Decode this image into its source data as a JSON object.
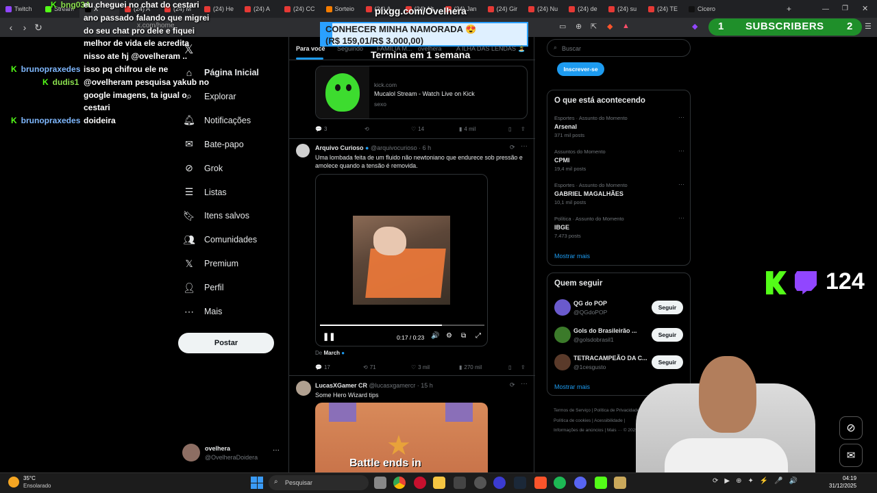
{
  "browser": {
    "tabs": [
      "Twitch",
      "Stream",
      "X",
      "(24) A",
      "(24) M",
      "(24) He",
      "(24) A",
      "(24) CC",
      "Sorteio",
      "(24) A",
      "(24) Alt",
      "(24) Jan",
      "(24) Gir",
      "(24) Nu",
      "(24) de",
      "(24) su",
      "(24) TE",
      "Cicero"
    ],
    "url": "x.com/home"
  },
  "stream_overlay": {
    "donation_url": "pixgg.com/Ovelhera",
    "goal_title": "CONHECER MINHA NAMORADA 😍",
    "goal_progress": "(R$ 159,01/R$ 3.000,00)",
    "goal_fraction": 0.053,
    "goal_deadline": "Termina em 1 semana",
    "subscribers_label": "SUBSCRIBERS",
    "subscribers_left": "1",
    "subscribers_right": "2",
    "viewer_count": "124"
  },
  "chat": [
    {
      "user": "bng034",
      "text": "eu cheguei no chat do cestari"
    },
    {
      "user": "",
      "text": "ano passado falando que migrei"
    },
    {
      "user": "",
      "text": "do seu chat pro dele e fiquei"
    },
    {
      "user": "",
      "text": "melhor de vida ele acredita"
    },
    {
      "user": "",
      "text": "nisso ate hj @ovelheram .."
    },
    {
      "user": "brunopraxedes",
      "text": "isso pq chifrou ele ne"
    },
    {
      "user": "dudis1",
      "text": "@ovelheram pesquisa yakub no"
    },
    {
      "user": "",
      "text": "google imagens, ta igual o"
    },
    {
      "user": "",
      "text": "cestari"
    },
    {
      "user": "brunopraxedes",
      "text": "doideira"
    }
  ],
  "sidebar": {
    "items": [
      {
        "label": "Página Inicial",
        "icon": "home-icon"
      },
      {
        "label": "Explorar",
        "icon": "search-icon"
      },
      {
        "label": "Notificações",
        "icon": "bell-icon"
      },
      {
        "label": "Bate-papo",
        "icon": "mail-icon"
      },
      {
        "label": "Grok",
        "icon": "grok-icon"
      },
      {
        "label": "Listas",
        "icon": "list-icon"
      },
      {
        "label": "Itens salvos",
        "icon": "bookmark-icon"
      },
      {
        "label": "Comunidades",
        "icon": "people-icon"
      },
      {
        "label": "Premium",
        "icon": "x-logo-icon"
      },
      {
        "label": "Perfil",
        "icon": "person-icon"
      },
      {
        "label": "Mais",
        "icon": "more-icon"
      }
    ],
    "post_label": "Postar",
    "account_name": "ovelhera",
    "account_handle": "@OvelheraDoidera"
  },
  "feed": {
    "tabs": [
      "Para você",
      "Seguindo",
      "FAMÍLIA M...",
      "ovelhera",
      "A ILHA DAS LENDAS 🏝️"
    ],
    "card": {
      "domain": "kick.com",
      "title": "Mucalol Stream - Watch Live on Kick",
      "desc": "sexo"
    },
    "card_actions": {
      "replies": "3",
      "likes": "14",
      "views": "4 mil"
    },
    "post": {
      "name": "Arquivo Curioso",
      "handle": "@arquivocurioso · 6 h",
      "text": "Uma lombada feita de um fluido não newtoniano que endurece sob pressão e amolece quando a tensão é removida.",
      "video_time": "0:17 / 0:23",
      "video_progress": 0.74,
      "from_label": "De",
      "from_name": "March",
      "replies": "17",
      "reposts": "71",
      "likes": "3 mil",
      "views": "270 mil"
    },
    "post2": {
      "name": "LucasXGamer CR",
      "handle": "@lucasxgamercr · 15 h",
      "text": "Some Hero Wizard tips",
      "image_caption": "Battle ends in"
    }
  },
  "right": {
    "search_placeholder": "Buscar",
    "subscribe_label": "Inscrever-se",
    "trending_title": "O que está acontecendo",
    "trends": [
      {
        "category": "Esportes · Assunto do Momento",
        "name": "Arsenal",
        "count": "371 mil posts"
      },
      {
        "category": "Assuntos do Momento",
        "name": "CPMI",
        "count": "19,4 mil posts"
      },
      {
        "category": "Esportes · Assunto do Momento",
        "name": "GABRIEL MAGALHÃES",
        "count": "10,1 mil posts"
      },
      {
        "category": "Política · Assunto do Momento",
        "name": "IBGE",
        "count": "7.473 posts"
      }
    ],
    "show_more": "Mostrar mais",
    "who_title": "Quem seguir",
    "who": [
      {
        "name": "QG do POP",
        "handle": "@QGdoPOP"
      },
      {
        "name": "Gols do Brasileirão ...",
        "handle": "@golsdobrasil1"
      },
      {
        "name": "TETRACAMPEÃO DA C...",
        "handle": "@1cesgusto"
      }
    ],
    "follow_label": "Seguir",
    "footer": [
      "Termos de Serviço",
      "Política de Privacidade",
      "Política de cookies",
      "Acessibilidade",
      "Informações de anúncios",
      "Mais ···",
      "© 2025 X Corp."
    ]
  },
  "taskbar": {
    "weather_temp": "35°C",
    "weather_desc": "Ensolarado",
    "search_placeholder": "Pesquisar",
    "time": "04:19",
    "date": "31/12/2025"
  },
  "colors": {
    "accent": "#1d9bf0",
    "kick_green": "#53fc18",
    "twitch_purple": "#9146ff"
  }
}
